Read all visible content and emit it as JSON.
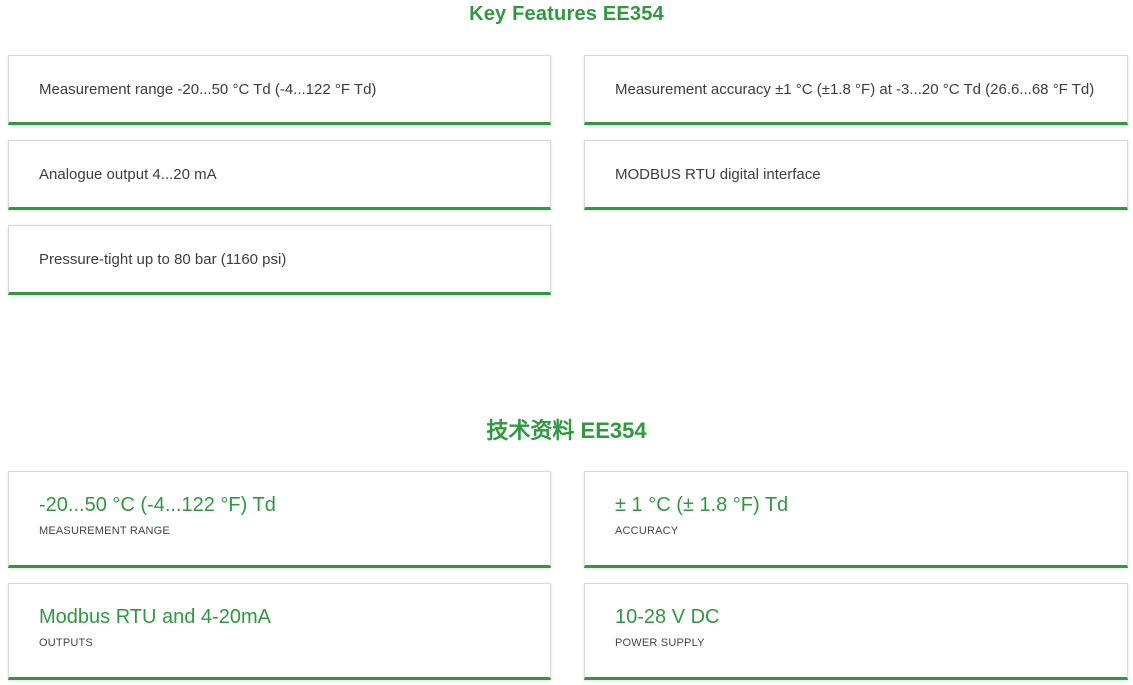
{
  "key_features": {
    "title": "Key Features EE354",
    "items": [
      "Measurement range -20...50 °C Td (-4...122 °F Td)",
      "Measurement accuracy ±1 °C (±1.8 °F) at -3...20 °C Td (26.6...68 °F Td)",
      "Analogue output 4...20 mA",
      "MODBUS RTU digital interface",
      "Pressure-tight up to 80 bar (1160 psi)"
    ]
  },
  "technical_data": {
    "title": "技术资料 EE354",
    "items": [
      {
        "value": "-20...50 °C (-4...122 °F) Td",
        "label": "MEASUREMENT RANGE"
      },
      {
        "value": "± 1 °C (± 1.8 °F) Td",
        "label": "ACCURACY"
      },
      {
        "value": "Modbus RTU and 4-20mA",
        "label": "OUTPUTS"
      },
      {
        "value": "10-28 V DC",
        "label": "POWER SUPPLY"
      }
    ]
  },
  "colors": {
    "accent": "#2e9a3f",
    "card_border": "#d9d9d9",
    "text": "#3d3d3d"
  }
}
